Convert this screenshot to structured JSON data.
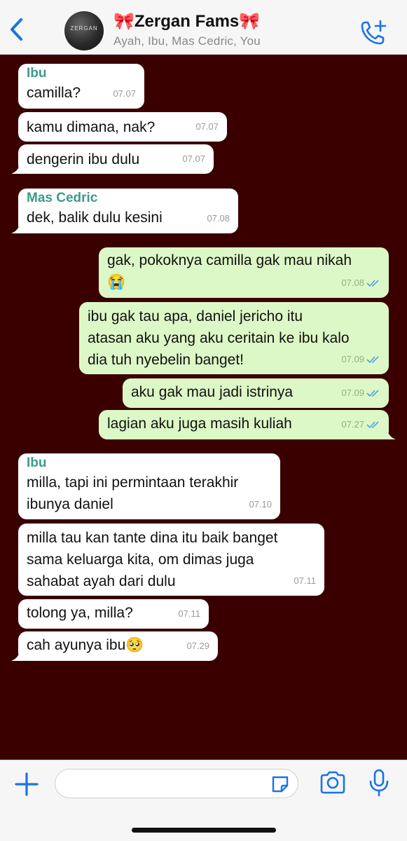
{
  "header": {
    "title": "🎀Zergan Fams🎀",
    "participants": "Ayah, Ibu, Mas Cedric, You",
    "avatar_text": "ZERGAN"
  },
  "messages": [
    {
      "sender": "Ibu",
      "text": "camilla?",
      "time": "07.07"
    },
    {
      "text": "kamu dimana, nak?",
      "time": "07.07"
    },
    {
      "text": "dengerin ibu dulu",
      "time": "07.07"
    },
    {
      "sender": "Mas Cedric",
      "text": "dek, balik dulu kesini",
      "time": "07.08"
    },
    {
      "line1": "gak, pokoknya camilla gak mau nikah",
      "line2": "😭",
      "time": "07.08"
    },
    {
      "line1": "ibu gak tau apa, daniel jericho itu",
      "line2": "atasan aku yang aku ceritain ke ibu kalo",
      "line3": "dia tuh nyebelin banget!",
      "time": "07.09"
    },
    {
      "text": "aku gak mau jadi istrinya",
      "time": "07.09"
    },
    {
      "text": "lagian aku juga masih kuliah",
      "time": "07.27"
    },
    {
      "sender": "Ibu",
      "line1": "milla, tapi ini permintaan terakhir",
      "line2": "ibunya daniel",
      "time": "07.10"
    },
    {
      "line1": "milla tau kan tante dina itu baik banget",
      "line2": "sama keluarga kita, om dimas juga",
      "line3": "sahabat ayah dari dulu",
      "time": "07.11"
    },
    {
      "text": "tolong ya, milla?",
      "time": "07.11"
    },
    {
      "text": "cah ayunya ibu🥺",
      "time": "07.29"
    }
  ],
  "colors": {
    "wallpaper": "#3a0000",
    "incoming": "#ffffff",
    "outgoing": "#dcf8c6",
    "accent": "#1a73e8",
    "sender_name": "#3d9a8b"
  },
  "icons": {
    "back": "chevron-left-icon",
    "call": "phone-plus-icon",
    "attach": "plus-icon",
    "sticker": "sticker-icon",
    "camera": "camera-icon",
    "mic": "microphone-icon"
  }
}
